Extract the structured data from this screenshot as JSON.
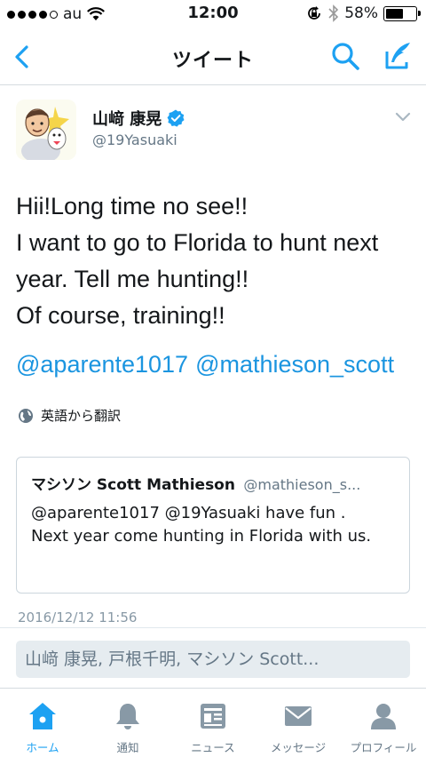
{
  "status_bar": {
    "carrier": "au",
    "time": "12:00",
    "battery_text": "58%",
    "battery_level": 0.58
  },
  "nav": {
    "title": "ツイート"
  },
  "tweet": {
    "author_name": "山﨑 康晃",
    "author_handle": "@19Yasuaki",
    "text_lines": [
      "Hii!Long time no see!!",
      "I want to go to Florida to hunt next",
      "year. Tell me hunting!!",
      "Of course, training!!"
    ],
    "mentions": [
      "@aparente1017",
      "@mathieson_scott"
    ],
    "translate_label": "英語から翻訳",
    "timestamp": "2016/12/12 11:56"
  },
  "quote": {
    "name": "マシソン Scott Mathieson",
    "handle": "@mathieson_s...",
    "text": "@aparente1017 @19Yasuaki have fun . Next year come hunting in Florida with us."
  },
  "reply": {
    "placeholder": "山﨑 康晃, 戸根千明, マシソン Scott..."
  },
  "tabs": [
    {
      "label": "ホーム",
      "icon": "home-icon",
      "active": true
    },
    {
      "label": "通知",
      "icon": "bell-icon",
      "active": false
    },
    {
      "label": "ニュース",
      "icon": "news-icon",
      "active": false
    },
    {
      "label": "メッセージ",
      "icon": "envelope-icon",
      "active": false
    },
    {
      "label": "プロフィール",
      "icon": "profile-icon",
      "active": false
    }
  ],
  "colors": {
    "accent": "#1da1f2",
    "link": "#1b95e0",
    "muted": "#657786"
  }
}
